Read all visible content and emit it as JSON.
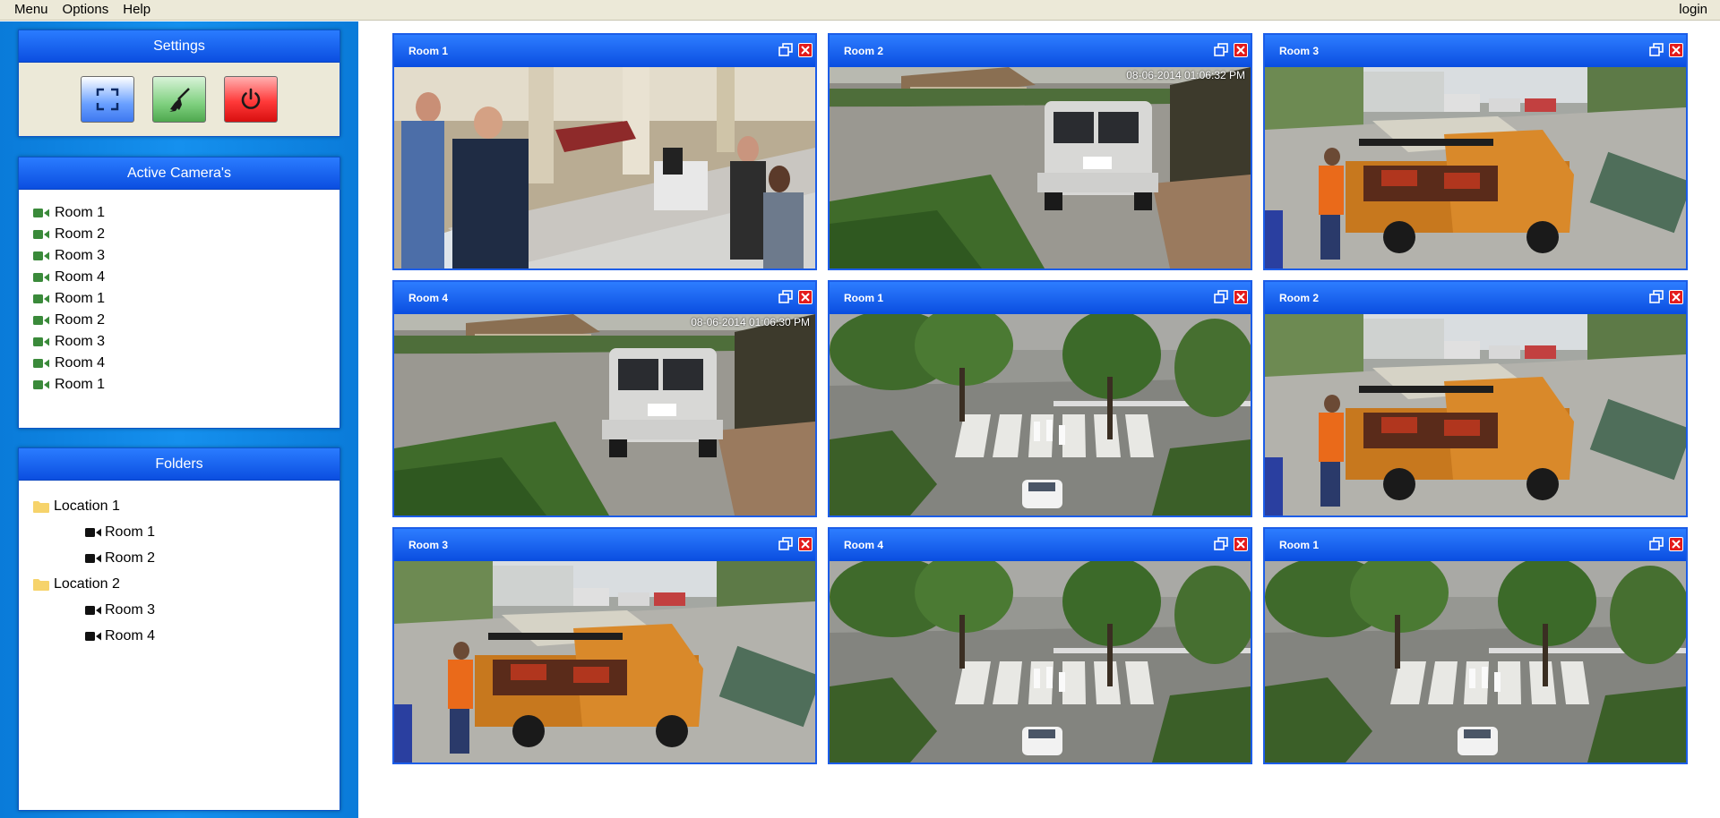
{
  "menubar": {
    "items": [
      "Menu",
      "Options",
      "Help"
    ],
    "login": "login"
  },
  "settings": {
    "title": "Settings",
    "buttons": [
      {
        "name": "fullscreen-button",
        "icon": "fullscreen-icon"
      },
      {
        "name": "clean-button",
        "icon": "broom-icon"
      },
      {
        "name": "power-button",
        "icon": "power-icon"
      }
    ]
  },
  "active_cameras": {
    "title": "Active Camera's",
    "items": [
      "Room 1",
      "Room 2",
      "Room 3",
      "Room 4",
      "Room 1",
      "Room 2",
      "Room 3",
      "Room 4",
      "Room 1"
    ]
  },
  "folders": {
    "title": "Folders",
    "tree": [
      {
        "label": "Location 1",
        "rooms": [
          "Room 1",
          "Room 2"
        ]
      },
      {
        "label": "Location 2",
        "rooms": [
          "Room 3",
          "Room 4"
        ]
      }
    ]
  },
  "tiles": [
    {
      "title": "Room 1",
      "scene": "lobby",
      "stamp": ""
    },
    {
      "title": "Room 2",
      "scene": "van",
      "stamp": "08-06-2014 01:06:32 PM"
    },
    {
      "title": "Room 3",
      "scene": "truck",
      "stamp": ""
    },
    {
      "title": "Room 4",
      "scene": "van",
      "stamp": "08-06-2014 01:06:30 PM"
    },
    {
      "title": "Room 1",
      "scene": "crossing",
      "stamp": ""
    },
    {
      "title": "Room 2",
      "scene": "truck",
      "stamp": ""
    },
    {
      "title": "Room 3",
      "scene": "truck",
      "stamp": ""
    },
    {
      "title": "Room 4",
      "scene": "crossing",
      "stamp": ""
    },
    {
      "title": "Room 1",
      "scene": "crossing",
      "stamp": ""
    }
  ],
  "colors": {
    "header_blue": "#0b4ee0",
    "sidebar_blue": "#1590ee",
    "menubar_bg": "#ece9d8",
    "camera_icon_green": "#3a8a3a",
    "close_red": "#e41b1b"
  }
}
